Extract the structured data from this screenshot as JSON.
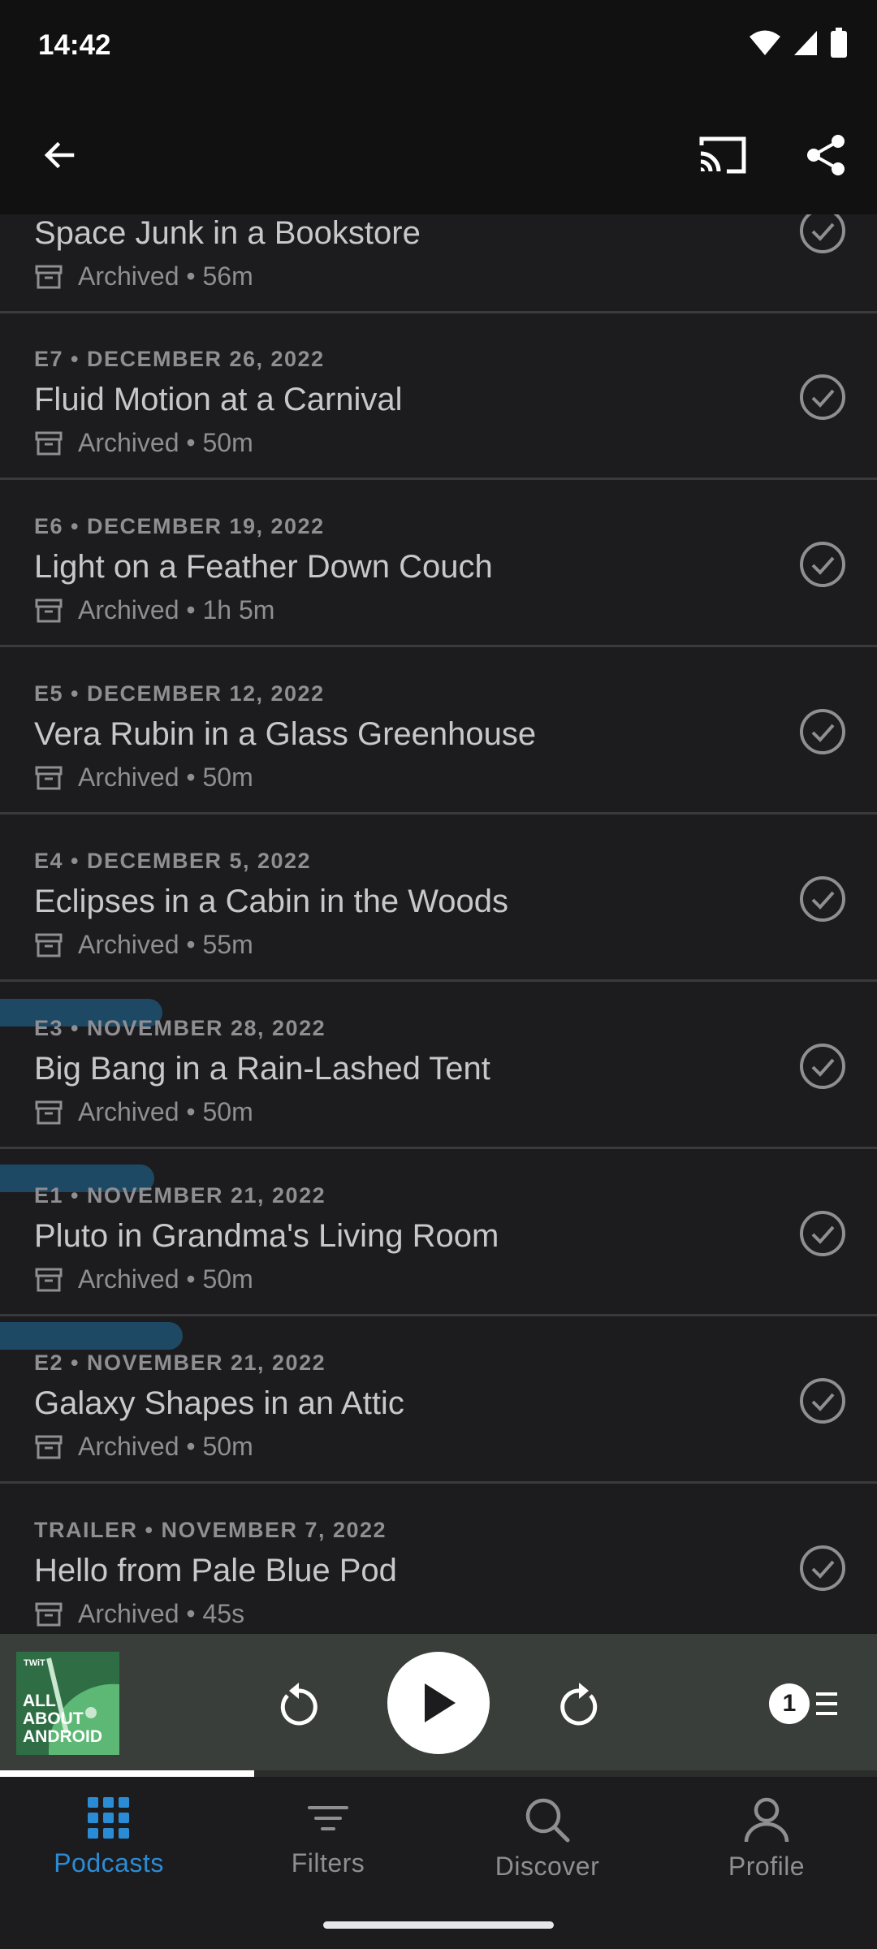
{
  "status_bar": {
    "time": "14:42"
  },
  "toolbar": {
    "back_icon": "arrow-back-icon",
    "cast_icon": "cast-icon",
    "share_icon": "share-icon"
  },
  "episodes": [
    {
      "meta": "",
      "title": "Space Junk in a Bookstore",
      "status": "Archived • 56m"
    },
    {
      "meta": "E7 • DECEMBER 26, 2022",
      "title": "Fluid Motion at a Carnival",
      "status": "Archived • 50m"
    },
    {
      "meta": "E6 • DECEMBER 19, 2022",
      "title": "Light on a Feather Down Couch",
      "status": "Archived • 1h 5m"
    },
    {
      "meta": "E5 • DECEMBER 12, 2022",
      "title": "Vera Rubin in a Glass Greenhouse",
      "status": "Archived • 50m"
    },
    {
      "meta": "E4 • DECEMBER 5, 2022",
      "title": "Eclipses in a Cabin in the Woods",
      "status": "Archived • 55m"
    },
    {
      "meta": "E3 • NOVEMBER 28, 2022",
      "title": "Big Bang in a Rain-Lashed Tent",
      "status": "Archived • 50m"
    },
    {
      "meta": "E1 • NOVEMBER 21, 2022",
      "title": "Pluto in Grandma's Living Room",
      "status": "Archived • 50m"
    },
    {
      "meta": "E2 • NOVEMBER 21, 2022",
      "title": "Galaxy Shapes in an Attic",
      "status": "Archived • 50m"
    },
    {
      "meta": "TRAILER • NOVEMBER 7, 2022",
      "title": "Hello from Pale Blue Pod",
      "status": "Archived • 45s"
    }
  ],
  "mini_player": {
    "artwork_brand": "TWiT",
    "artwork_title": "ALL ABOUT ANDROID",
    "queue_count": "1",
    "progress": 0.29
  },
  "bottom_nav": [
    {
      "label": "Podcasts",
      "icon": "grid-icon",
      "active": true
    },
    {
      "label": "Filters",
      "icon": "filter-icon",
      "active": false
    },
    {
      "label": "Discover",
      "icon": "search-icon",
      "active": false
    },
    {
      "label": "Profile",
      "icon": "profile-icon",
      "active": false
    }
  ],
  "colors": {
    "accent": "#2b8cd6",
    "background": "#1c1c1e",
    "miniplayer": "#3a3e3a"
  }
}
